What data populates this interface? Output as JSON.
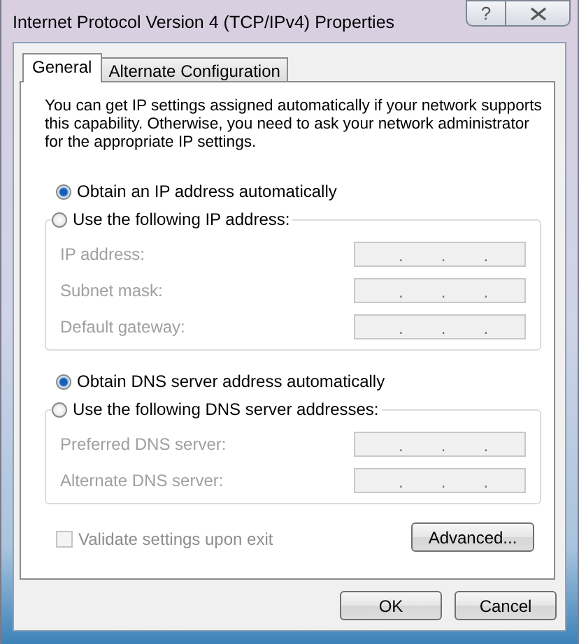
{
  "window": {
    "title": "Internet Protocol Version 4 (TCP/IPv4) Properties",
    "help_button": "?"
  },
  "tabs": [
    {
      "label": "General",
      "selected": true
    },
    {
      "label": "Alternate Configuration",
      "selected": false
    }
  ],
  "description": "You can get IP settings assigned automatically if your network supports this capability. Otherwise, you need to ask your network administrator for the appropriate IP settings.",
  "ip_options": [
    {
      "label": "Obtain an IP address automatically",
      "selected": true
    },
    {
      "label": "Use the following IP address:",
      "selected": false
    }
  ],
  "ip_fields": [
    {
      "label": "IP address:",
      "dots": [
        ".",
        ".",
        "."
      ],
      "disabled": true
    },
    {
      "label": "Subnet mask:",
      "dots": [
        ".",
        ".",
        "."
      ],
      "disabled": true
    },
    {
      "label": "Default gateway:",
      "dots": [
        ".",
        ".",
        "."
      ],
      "disabled": true
    }
  ],
  "dns_options": [
    {
      "label": "Obtain DNS server address automatically",
      "selected": true
    },
    {
      "label": "Use the following DNS server addresses:",
      "selected": false
    }
  ],
  "dns_fields": [
    {
      "label": "Preferred DNS server:",
      "dots": [
        ".",
        ".",
        "."
      ],
      "disabled": true
    },
    {
      "label": "Alternate DNS server:",
      "dots": [
        ".",
        ".",
        "."
      ],
      "disabled": true
    }
  ],
  "validate": {
    "label": "Validate settings upon exit",
    "checked": false,
    "disabled": true
  },
  "advanced_button": "Advanced...",
  "buttons": [
    "OK",
    "Cancel"
  ]
}
